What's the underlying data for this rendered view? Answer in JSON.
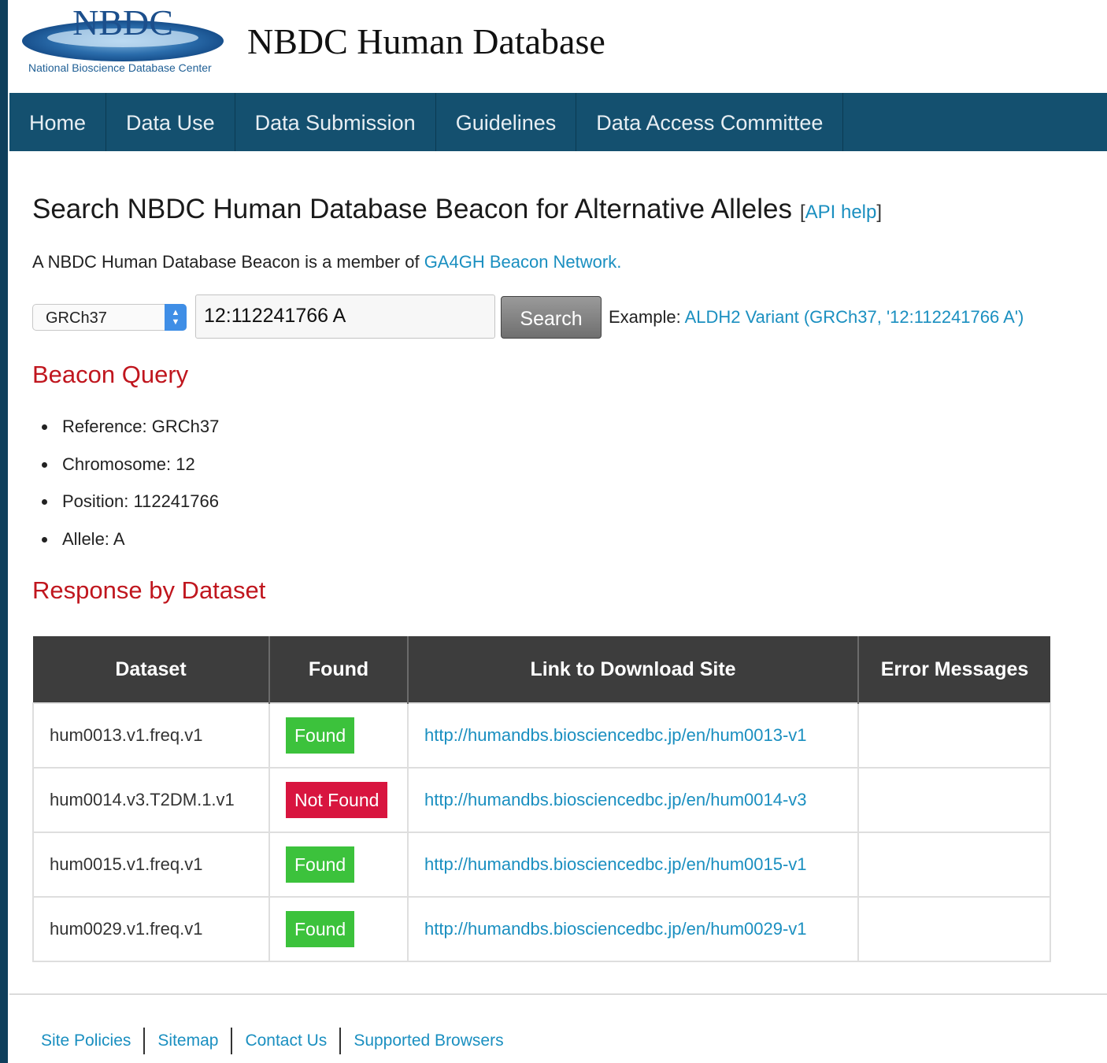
{
  "header": {
    "logo_text": "NBDC",
    "logo_subtitle": "National Bioscience Database Center",
    "site_title": "NBDC Human Database"
  },
  "nav": {
    "items": [
      "Home",
      "Data Use",
      "Data Submission",
      "Guidelines",
      "Data Access Committee"
    ]
  },
  "page": {
    "heading": "Search NBDC Human Database Beacon for Alternative Alleles",
    "api_help_open": "[",
    "api_help": "API help",
    "api_help_close": "]",
    "intro_text": "A NBDC Human Database Beacon is a member of ",
    "intro_link": "GA4GH Beacon Network."
  },
  "search": {
    "assembly": "GRCh37",
    "query": "12:112241766 A",
    "button_label": "Search",
    "example_label": "Example: ",
    "example_link": "ALDH2 Variant (GRCh37, '12:112241766 A')"
  },
  "beacon_query": {
    "title": "Beacon Query",
    "items": [
      "Reference: GRCh37",
      "Chromosome: 12",
      "Position: 112241766",
      "Allele: A"
    ]
  },
  "response": {
    "title": "Response by Dataset",
    "columns": [
      "Dataset",
      "Found",
      "Link to Download Site",
      "Error Messages"
    ],
    "rows": [
      {
        "dataset": "hum0013.v1.freq.v1",
        "status": "Found",
        "link": "http://humandbs.biosciencedbc.jp/en/hum0013-v1",
        "error": ""
      },
      {
        "dataset": "hum0014.v3.T2DM.1.v1",
        "status": "Not Found",
        "link": "http://humandbs.biosciencedbc.jp/en/hum0014-v3",
        "error": ""
      },
      {
        "dataset": "hum0015.v1.freq.v1",
        "status": "Found",
        "link": "http://humandbs.biosciencedbc.jp/en/hum0015-v1",
        "error": ""
      },
      {
        "dataset": "hum0029.v1.freq.v1",
        "status": "Found",
        "link": "http://humandbs.biosciencedbc.jp/en/hum0029-v1",
        "error": ""
      }
    ]
  },
  "footer": {
    "links": [
      "Site Policies",
      "Sitemap",
      "Contact Us",
      "Supported Browsers"
    ]
  },
  "colors": {
    "nav_bg": "#14506f",
    "section_title": "#c0161e",
    "link": "#1a8fc0",
    "found": "#3cc23c",
    "not_found": "#d8153f",
    "table_header": "#3d3d3d"
  }
}
